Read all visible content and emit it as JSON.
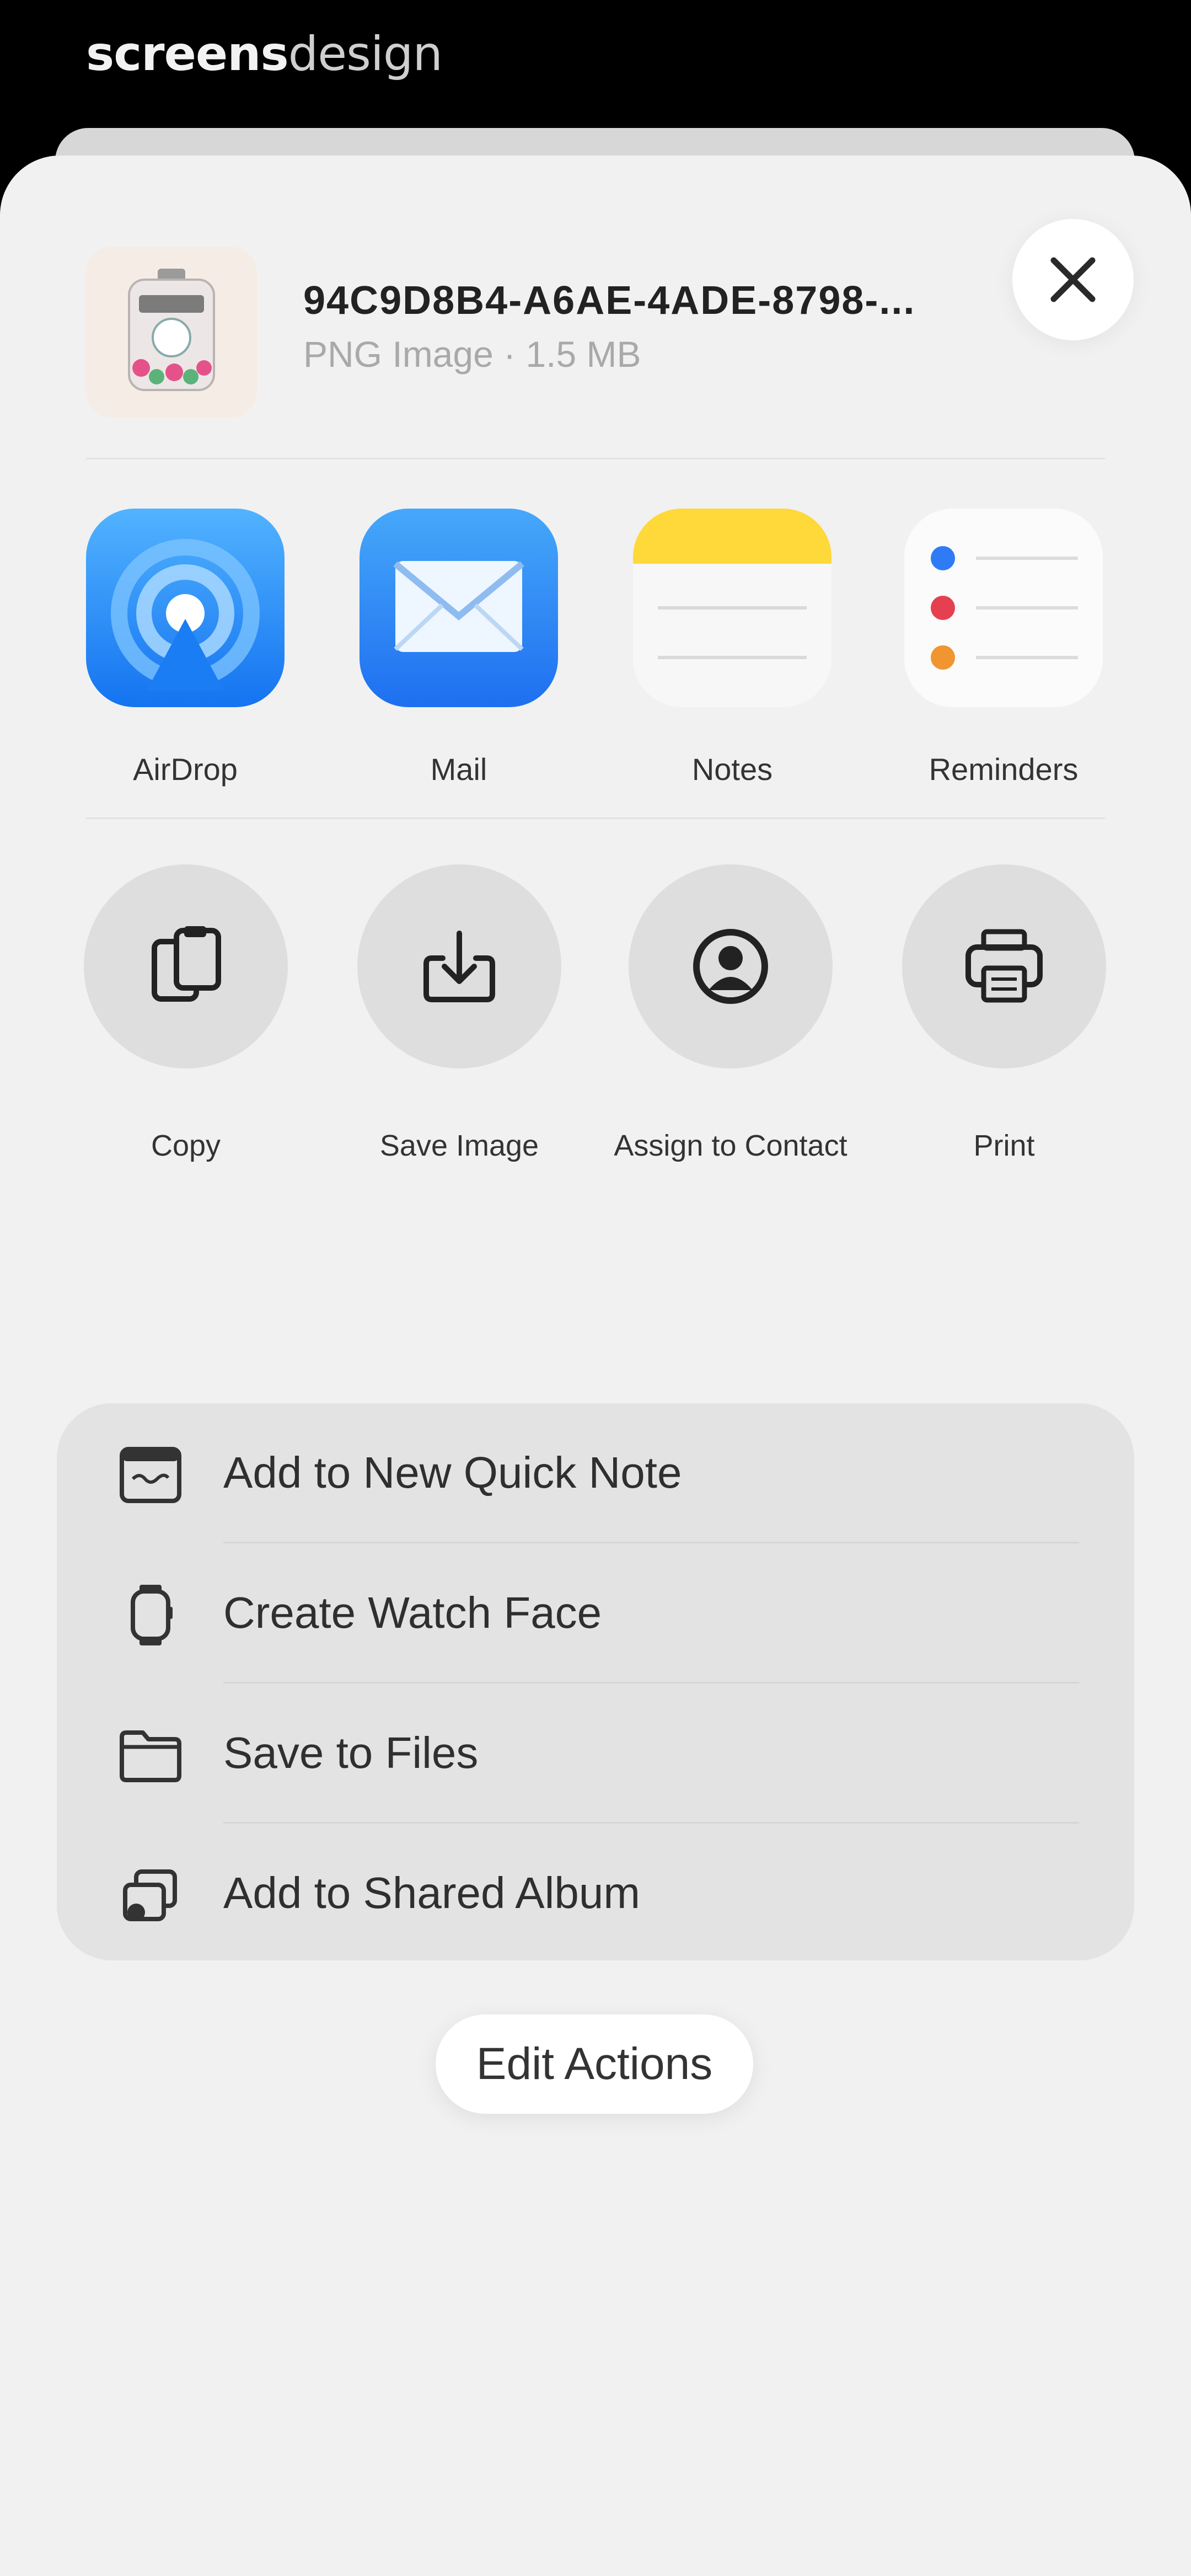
{
  "brand": {
    "part1": "screens",
    "part2": "design"
  },
  "share_sheet": {
    "file": {
      "name": "94C9D8B4-A6AE-4ADE-8798-...",
      "meta": "PNG Image · 1.5 MB"
    },
    "close_icon": "close-icon",
    "apps": [
      {
        "label": "AirDrop",
        "icon": "airdrop-icon"
      },
      {
        "label": "Mail",
        "icon": "mail-icon"
      },
      {
        "label": "Notes",
        "icon": "notes-icon"
      },
      {
        "label": "Reminders",
        "icon": "reminders-icon"
      }
    ],
    "actions": [
      {
        "label": "Copy",
        "icon": "copy-icon"
      },
      {
        "label": "Save Image",
        "icon": "save-image-icon"
      },
      {
        "label": "Assign to Contact",
        "icon": "contact-icon"
      },
      {
        "label": "Print",
        "icon": "printer-icon"
      }
    ],
    "list": [
      {
        "label": "Add to New Quick Note",
        "icon": "quick-note-icon"
      },
      {
        "label": "Create Watch Face",
        "icon": "watch-icon"
      },
      {
        "label": "Save to Files",
        "icon": "folder-icon"
      },
      {
        "label": "Add to Shared Album",
        "icon": "shared-album-icon"
      }
    ],
    "edit_label": "Edit Actions"
  },
  "colors": {
    "airdrop_blue": "#1E8BFF",
    "mail_blue": "#2E88F6",
    "notes_yellow": "#FFD83A",
    "reminder_blue": "#2F7BF6",
    "reminder_red": "#E5404F",
    "reminder_orange": "#F0952F"
  }
}
